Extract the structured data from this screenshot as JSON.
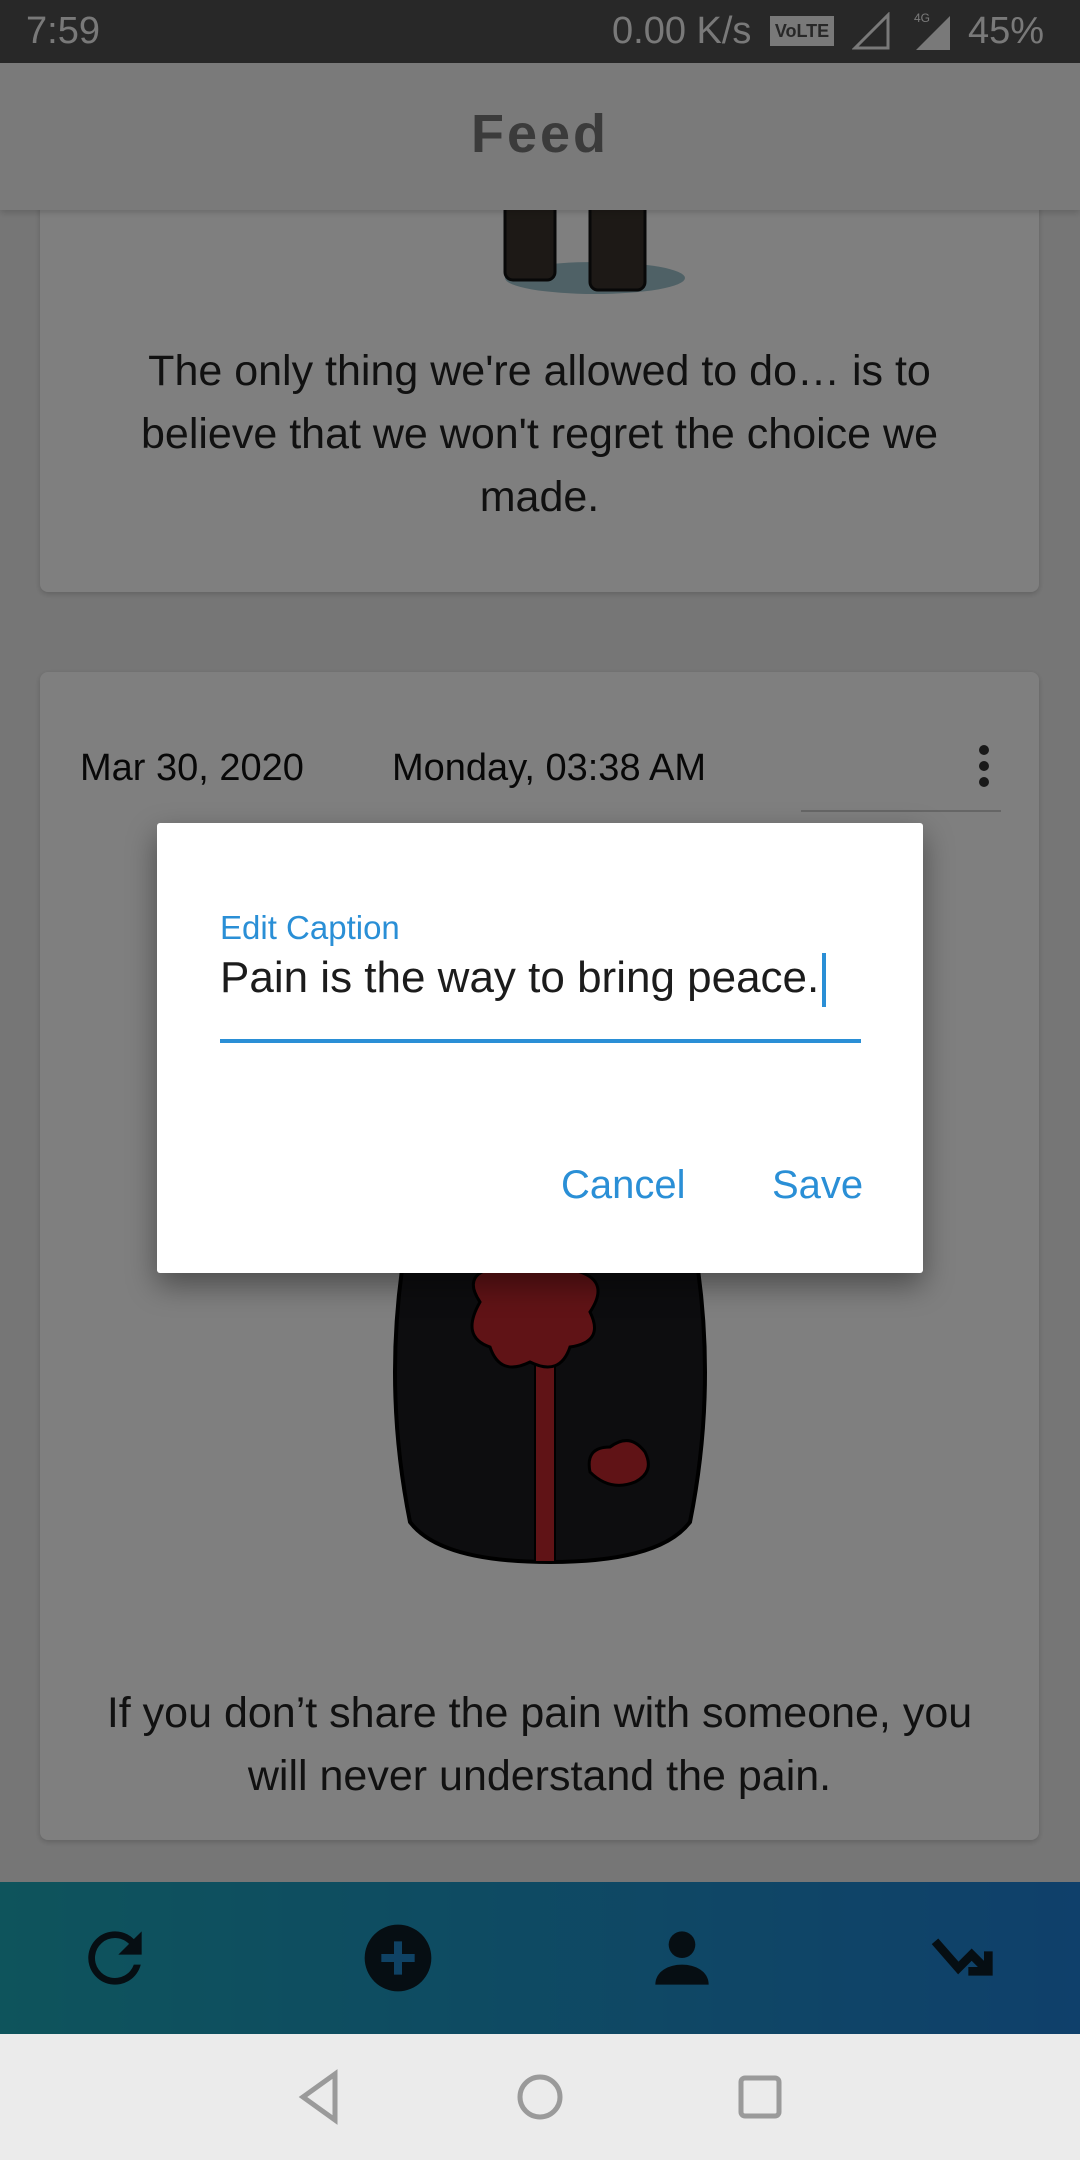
{
  "status_bar": {
    "time": "7:59",
    "net_speed": "0.00 K/s",
    "volte_badge": "VoLTE",
    "network_type": "4G",
    "battery": "45%"
  },
  "app_bar": {
    "title": "Feed"
  },
  "feed": {
    "posts": [
      {
        "caption": "The only thing we're allowed to do… is to believe that we won't regret the choice we made."
      },
      {
        "date": "Mar 30, 2020",
        "day_time": "Monday, 03:38 AM",
        "caption": "If you don’t share the pain with someone, you will never understand the pain."
      }
    ]
  },
  "dialog": {
    "field_label": "Edit Caption",
    "field_value": "Pain is the way to bring peace.",
    "cancel_label": "Cancel",
    "save_label": "Save"
  },
  "bottom_nav": {
    "items": [
      {
        "icon": "refresh-icon"
      },
      {
        "icon": "add-circle-icon"
      },
      {
        "icon": "person-icon"
      },
      {
        "icon": "trending-icon"
      }
    ]
  },
  "colors": {
    "accent": "#2a8fd6",
    "nav_gradient_start": "#1ca8b8",
    "nav_gradient_end": "#1f80d6"
  }
}
